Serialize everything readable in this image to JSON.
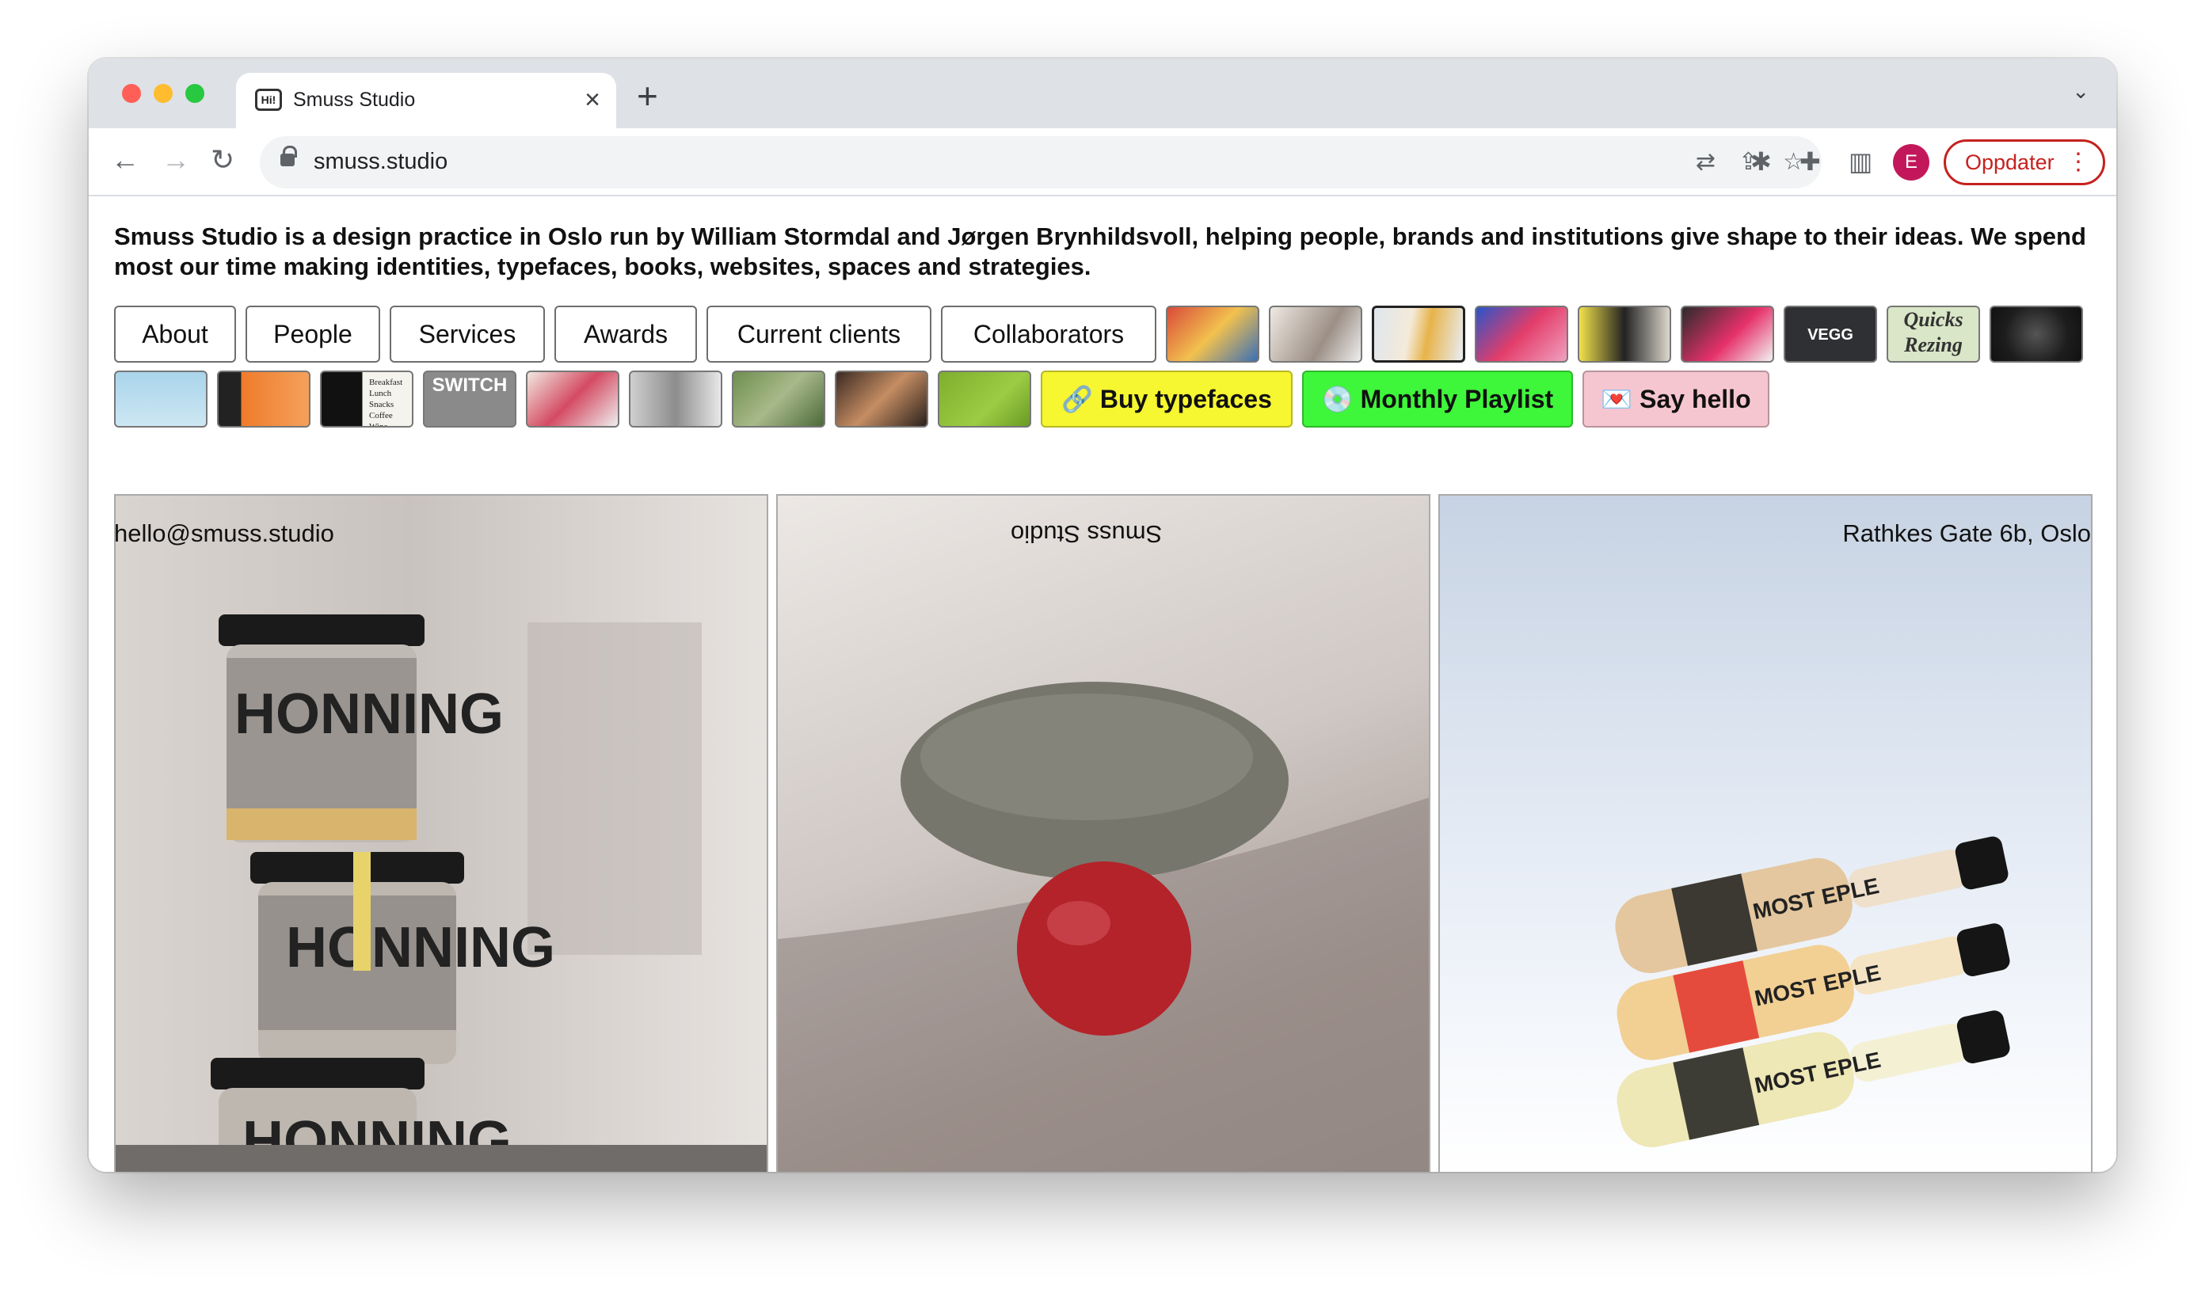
{
  "browser": {
    "tab_title": "Smuss Studio",
    "favicon_text": "Hi!",
    "url": "smuss.studio",
    "avatar_letter": "E",
    "update_label": "Oppdater"
  },
  "intro": "Smuss Studio is a design practice in Oslo run by William Stormdal and Jørgen Brynhildsvoll, helping people, brands and institutions give shape to their ideas. We spend most our time making identities, typefaces, books, websites, spaces and strategies.",
  "nav": {
    "about": "About",
    "people": "People",
    "services": "Services",
    "awards": "Awards",
    "current_clients": "Current clients",
    "collaborators": "Collaborators"
  },
  "actions": {
    "buy_typefaces": "🔗 Buy typefaces",
    "monthly_playlist": "💿 Monthly Playlist",
    "say_hello": "💌 Say hello"
  },
  "thumb_texts": {
    "quicks": "Quicks",
    "rezing": "Rezing",
    "switch": "SWITCH",
    "vegg": "VEGG",
    "menu": "Breakfast Lunch Snacks Coffee Wine"
  },
  "photos": {
    "jar_label": "HONNING",
    "bottle_label": "MOST EPLE"
  },
  "footer": {
    "email": "hello@smuss.studio",
    "name": "Smuss Studio",
    "address": "Rathkes Gate 6b, Oslo"
  },
  "colors": {
    "yellow": "#f6f631",
    "green": "#3ef63a",
    "pink": "#f6c6d0",
    "update_red": "#c5221f",
    "avatar": "#c2185b"
  }
}
